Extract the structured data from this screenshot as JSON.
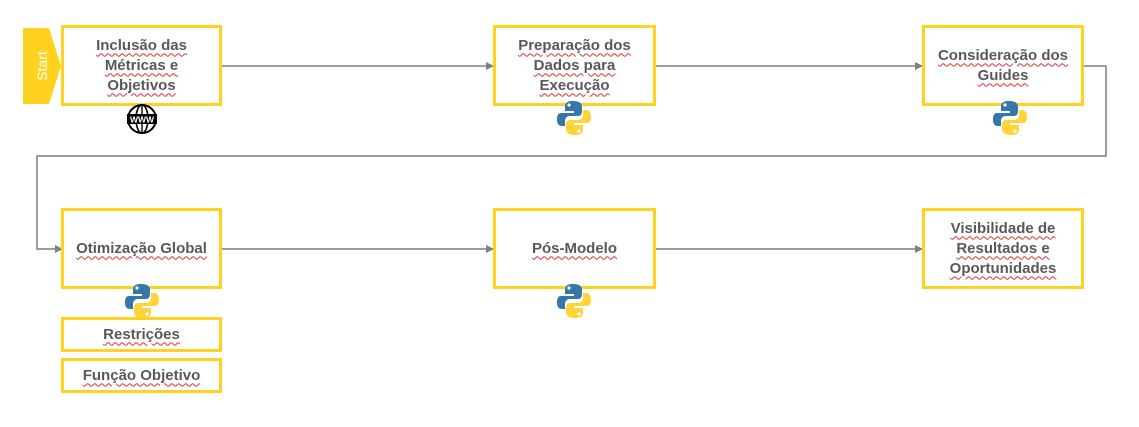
{
  "start": {
    "label": "Start"
  },
  "steps": [
    {
      "label": "Inclusão das Métricas e Objetivos",
      "icon": "www-globe-icon"
    },
    {
      "label": "Preparação dos Dados para Execução",
      "icon": "python-icon"
    },
    {
      "label": "Consideração dos Guides",
      "icon": "python-icon"
    },
    {
      "label": "Otimização Global",
      "icon": "python-icon"
    },
    {
      "label": "Pós-Modelo",
      "icon": "python-icon"
    },
    {
      "label": "Visibilidade de Resultados e Oportunidades"
    }
  ],
  "sub_boxes": [
    {
      "label": "Restrições"
    },
    {
      "label": "Função Objetivo"
    }
  ],
  "globe_text": "WWW",
  "colors": {
    "accent": "#FFD21F",
    "text": "#595959",
    "connector": "#7F7F7F",
    "python_blue": "#3776AB",
    "python_yellow": "#FFD43B"
  }
}
